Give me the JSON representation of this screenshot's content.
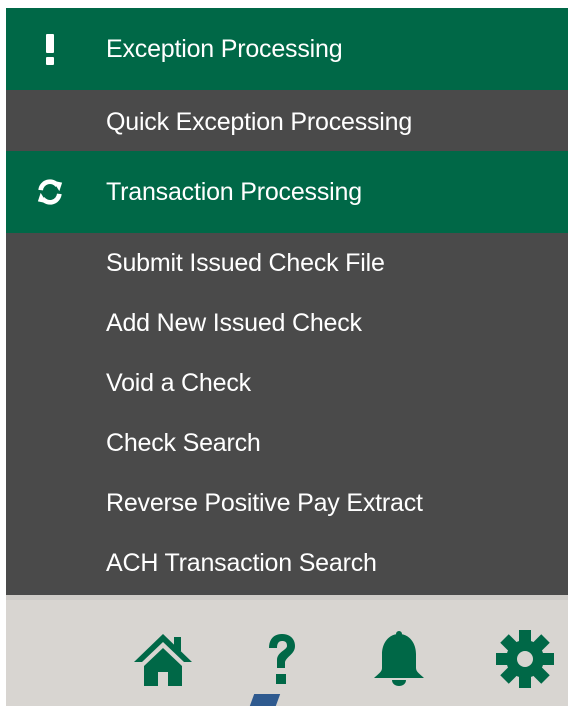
{
  "menu": {
    "sections": [
      {
        "icon": "exclamation-icon",
        "label": "Exception Processing",
        "items": [
          "Quick Exception Processing"
        ]
      },
      {
        "icon": "sync-icon",
        "label": "Transaction Processing",
        "items": [
          "Submit Issued Check File",
          "Add New Issued Check",
          "Void a Check",
          "Check Search",
          "Reverse Positive Pay Extract",
          "ACH Transaction Search"
        ]
      }
    ]
  },
  "toolbar": {
    "icons": [
      "home-icon",
      "help-icon",
      "notification-bell-icon",
      "settings-gear-icon"
    ]
  },
  "colors": {
    "accent": "#006847",
    "menu_background": "#4a4a4a",
    "toolbar_background": "#d8d5d1"
  }
}
